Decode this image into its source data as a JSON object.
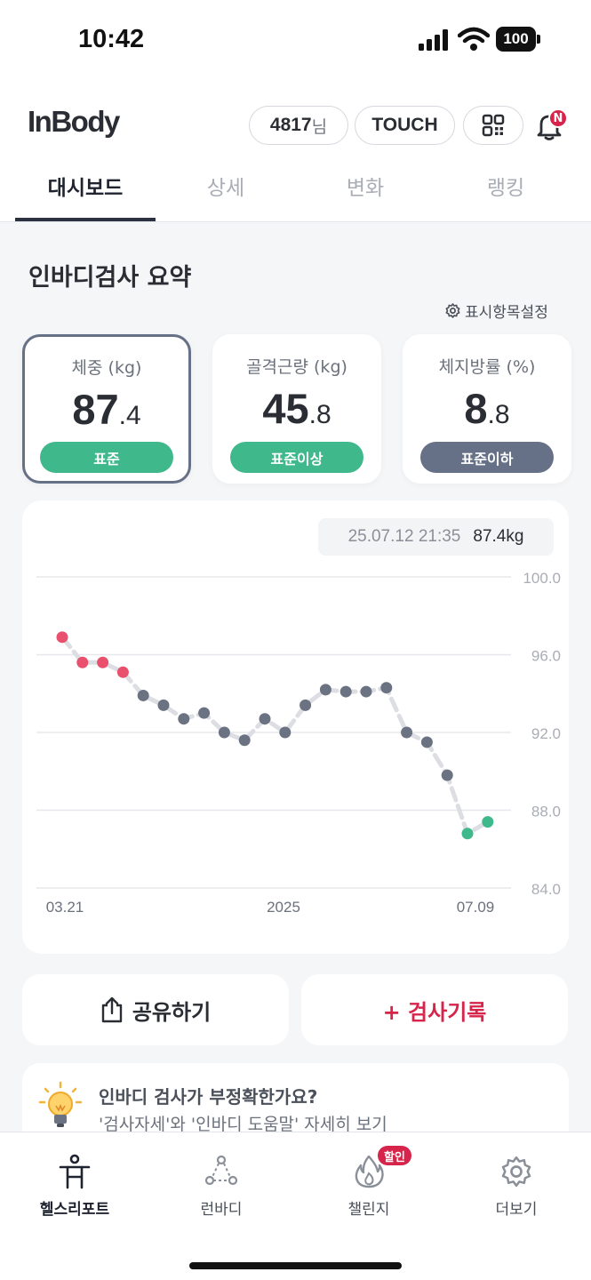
{
  "status_bar": {
    "time": "10:42",
    "battery": "100"
  },
  "header": {
    "logo": "InBody",
    "user_id": "4817",
    "user_suffix": "님",
    "touch_label": "TOUCH",
    "notification_badge": "N"
  },
  "tabs": [
    "대시보드",
    "상세",
    "변화",
    "랭킹"
  ],
  "active_tab": 0,
  "summary": {
    "title": "인바디검사 요약",
    "settings_label": "표시항목설정"
  },
  "metrics": [
    {
      "label": "체중 (kg)",
      "int": "87",
      "dec": ".4",
      "badge": "표준",
      "badge_color": "#3fb88c"
    },
    {
      "label": "골격근량 (kg)",
      "int": "45",
      "dec": ".8",
      "badge": "표준이상",
      "badge_color": "#3fb88c"
    },
    {
      "label": "체지방률 (%)",
      "int": "8",
      "dec": ".8",
      "badge": "표준이하",
      "badge_color": "#667086"
    }
  ],
  "chart_tooltip": {
    "date": "25.07.12 21:35",
    "value": "87.4kg"
  },
  "chart_data": {
    "type": "line",
    "ylim": [
      84.0,
      100.0
    ],
    "yticks": [
      "100.0",
      "96.0",
      "92.0",
      "88.0",
      "84.0"
    ],
    "xticks": [
      "03.21",
      "2025",
      "07.09"
    ],
    "values": [
      96.9,
      95.6,
      95.6,
      95.1,
      93.9,
      93.4,
      92.7,
      93.0,
      92.0,
      91.6,
      92.7,
      92.0,
      93.4,
      94.2,
      94.1,
      94.1,
      94.3,
      92.0,
      91.5,
      89.8,
      86.8,
      87.4
    ],
    "point_colors": [
      "#e8506e",
      "#e8506e",
      "#e8506e",
      "#e8506e",
      "#6b7382",
      "#6b7382",
      "#6b7382",
      "#6b7382",
      "#6b7382",
      "#6b7382",
      "#6b7382",
      "#6b7382",
      "#6b7382",
      "#6b7382",
      "#6b7382",
      "#6b7382",
      "#6b7382",
      "#6b7382",
      "#6b7382",
      "#6b7382",
      "#3fb88c",
      "#3fb88c"
    ],
    "grid": true
  },
  "actions": {
    "share": "공유하기",
    "add": "+ 검사기록"
  },
  "tip": {
    "title": "인바디 검사가 부정확한가요?",
    "subtitle": "'검사자세'와 '인바디 도움말' 자세히 보기"
  },
  "bottom_nav": [
    {
      "label": "헬스리포트",
      "icon": "person-icon"
    },
    {
      "label": "런바디",
      "icon": "runbody-icon"
    },
    {
      "label": "챌린지",
      "icon": "flame-icon"
    },
    {
      "label": "더보기",
      "icon": "gear-icon"
    }
  ],
  "challenge_badge": "할인"
}
